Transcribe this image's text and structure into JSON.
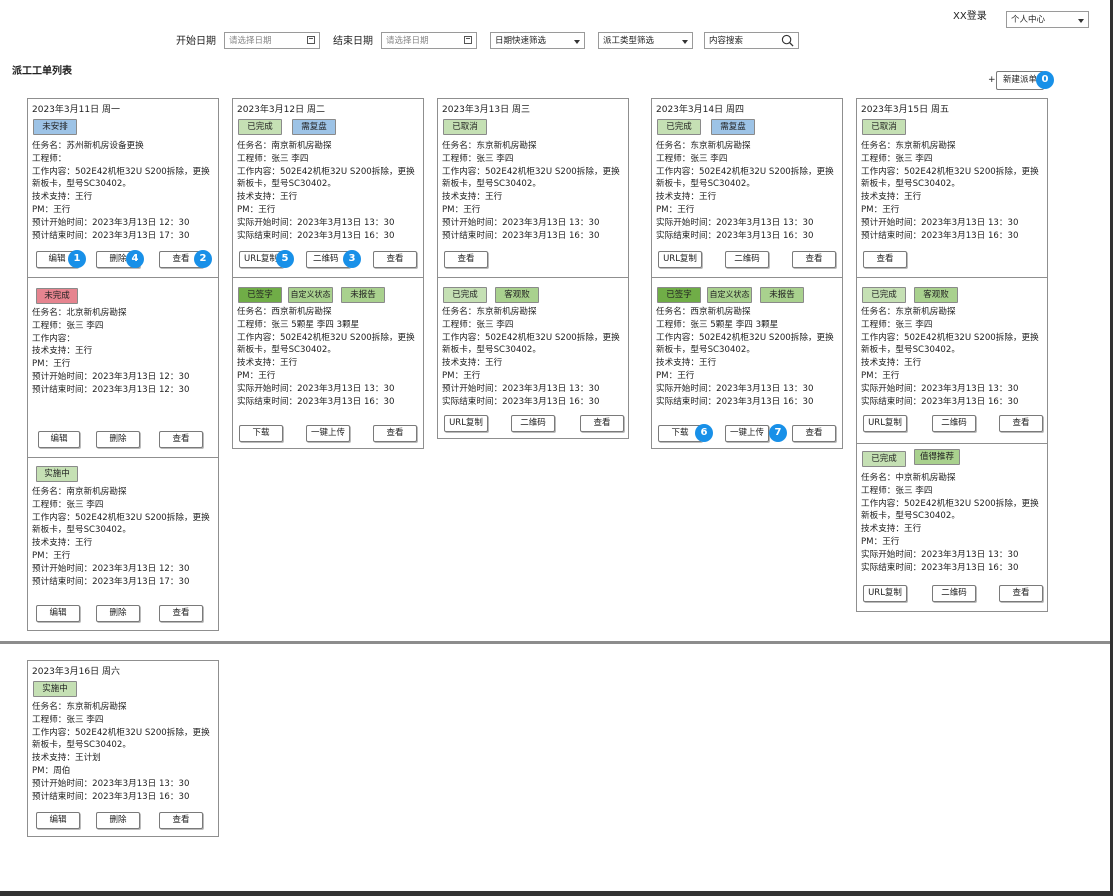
{
  "header": {
    "user_login": "XX登录",
    "personal_center": "个人中心",
    "start_date_label": "开始日期",
    "start_date_placeholder": "请选择日期",
    "end_date_label": "结束日期",
    "end_date_placeholder": "请选择日期",
    "date_quick_filter": "日期快速筛选",
    "type_filter": "派工类型筛选",
    "content_search": "内容搜索"
  },
  "page_title": "派工工单列表",
  "new_order": {
    "plus": "+",
    "label": "新建派单",
    "badge": "0"
  },
  "labels": {
    "task": "任务名：",
    "engineer": "工程师：",
    "content": "工作内容：",
    "support": "技术支持：",
    "pm": "PM：",
    "plan_start": "预计开始时间：",
    "plan_end": "预计结束时间：",
    "actual_start": "实际开始时间：",
    "actual_end": "实际结束时间："
  },
  "buttons": {
    "edit": "编辑",
    "delete": "删除",
    "view": "查看",
    "url_copy": "URL复制",
    "qrcode": "二维码",
    "download": "下载",
    "upload": "一键上传"
  },
  "badges": [
    "1",
    "4",
    "2",
    "5",
    "3",
    "6",
    "7"
  ],
  "dates": {
    "d1": "2023年3月11日 周一",
    "d2": "2023年3月12日 周二",
    "d3": "2023年3月13日 周三",
    "d4": "2023年3月14日 周四",
    "d5": "2023年3月15日 周五",
    "d6": "2023年3月16日 周六"
  },
  "tags": {
    "unarranged": "未安排",
    "unfinished": "未完成",
    "implementing": "实施中",
    "completed": "已完成",
    "needs_review": "需复盘",
    "cancelled": "已取消",
    "signed": "已签字",
    "custom_status": "自定义状态",
    "not_reported": "未报告",
    "customer_praise": "客观败",
    "recommend": "值得推荐"
  },
  "values": {
    "task_suzhou": "苏州新机房设备更换",
    "task_nanjing": "南京新机房勘探",
    "task_beijing": "北京新机房勘探",
    "task_xijing": "西京新机房勘探",
    "task_dongjing": "东京新机房勘探",
    "task_zhongjing": "中京新机房勘探",
    "eng_zs_ls": "张三 李四",
    "eng_zs5_ls3": "张三 5颗星 李四 3颗星",
    "eng_zsls": "张三 李四",
    "content_line1": "502E42机柜32U S200拆除，更换",
    "content_line2": "新板卡，型号SC30402。",
    "support_wx": "王行",
    "support_wjh": "王计划",
    "pm_wx": "王行",
    "pm_zb": "周伯",
    "t_1230": "2023年3月13日 12：30",
    "t_1730": "2023年3月13日 17：30",
    "t_1330": "2023年3月13日 13：30",
    "t_1630": "2023年3月13日 16：30"
  }
}
